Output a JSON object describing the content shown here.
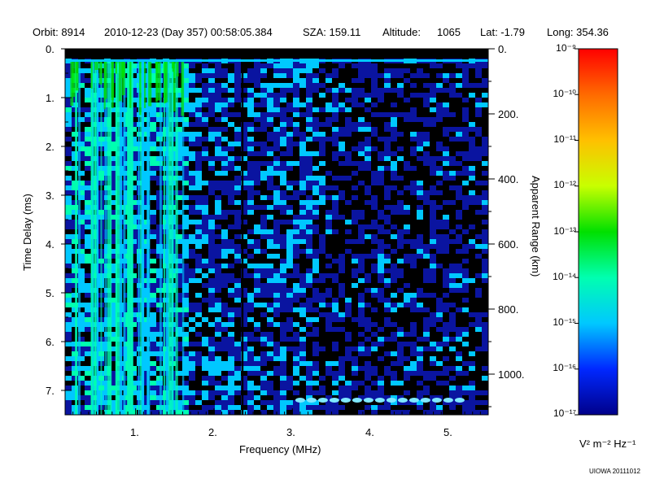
{
  "header": {
    "orbit": "Orbit: 8914",
    "datetime": "2010-12-23 (Day 357) 00:58:05.384",
    "sza": "SZA: 159.11",
    "altitude_label": "Altitude:",
    "altitude_value": "1065",
    "lat": "Lat:  -1.79",
    "long": "Long: 354.36"
  },
  "chart_data": {
    "type": "heatmap",
    "xlabel": "Frequency (MHz)",
    "ylabel": "Time Delay (ms)",
    "y2label": "Apparent Range (km)",
    "xlim": [
      0.1,
      5.5
    ],
    "ylim": [
      0,
      7.5
    ],
    "y_inverted": true,
    "x_ticks": [
      "1.",
      "2.",
      "3.",
      "4.",
      "5."
    ],
    "x_tick_values": [
      1,
      2,
      3,
      4,
      5
    ],
    "y_ticks": [
      "0.",
      "1.",
      "2.",
      "3.",
      "4.",
      "5.",
      "6.",
      "7."
    ],
    "y_tick_values": [
      0,
      1,
      2,
      3,
      4,
      5,
      6,
      7
    ],
    "y2_ticks": [
      "0.",
      "200.",
      "400.",
      "600.",
      "800.",
      "1000."
    ],
    "y2_tick_values_ms": [
      0,
      1.33,
      2.67,
      4.0,
      5.33,
      6.67
    ],
    "colorbar": {
      "label": "V² m⁻² Hz⁻¹",
      "scale": "log",
      "range": [
        1e-17,
        1e-09
      ],
      "tick_labels": [
        "10⁻⁹",
        "10⁻¹⁰",
        "10⁻¹¹",
        "10⁻¹²",
        "10⁻¹³",
        "10⁻¹⁴",
        "10⁻¹⁵",
        "10⁻¹⁶",
        "10⁻¹⁷"
      ],
      "colors": [
        "#ff0000",
        "#ff6a00",
        "#ffc000",
        "#c8ff00",
        "#00e000",
        "#00ffb0",
        "#00c8ff",
        "#0028ff",
        "#00008a"
      ]
    },
    "features": {
      "vertical_line_mhz": 2.35,
      "surface_reflection_ms": 7.2,
      "surface_reflection_mhz_range": [
        3.1,
        5.2
      ]
    }
  },
  "footer": {
    "credit": "UIOWA 20111012"
  }
}
